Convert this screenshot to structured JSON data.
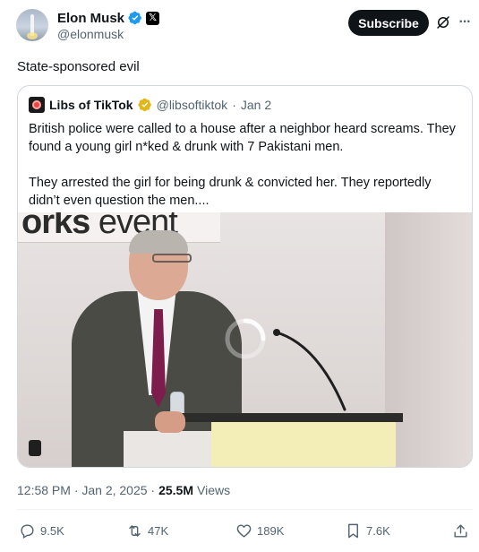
{
  "author": {
    "name": "Elon Musk",
    "handle": "@elonmusk",
    "affiliation_badge": "𝕏"
  },
  "subscribe_label": "Subscribe",
  "post_text": "State-sponsored evil",
  "quoted": {
    "name": "Libs of TikTok",
    "handle": "@libsoftiktok",
    "separator": "·",
    "date": "Jan 2",
    "paragraph_1": "British police were called to a house after a neighbor heard screams. They found a young girl n*ked & drunk with 7 Pakistani men.",
    "paragraph_2": "They arrested the girl for being drunk & convicted her. They reportedly didn’t even question the men....",
    "media_banner_bold": "orks",
    "media_banner_rest": " event"
  },
  "meta": {
    "time_date": "12:58 PM · Jan 2, 2025 ·",
    "views_count": "25.5M",
    "views_label": "Views"
  },
  "actions": {
    "replies": "9.5K",
    "reposts": "47K",
    "likes": "189K",
    "bookmarks": "7.6K"
  },
  "colors": {
    "verified_blue": "#1d9bf0",
    "verified_gold": "#e2b719",
    "secondary_text": "#536471",
    "border": "#cfd9de"
  },
  "icons": [
    "grok-icon",
    "more-icon",
    "reply-icon",
    "repost-icon",
    "like-icon",
    "bookmark-icon",
    "share-icon"
  ]
}
